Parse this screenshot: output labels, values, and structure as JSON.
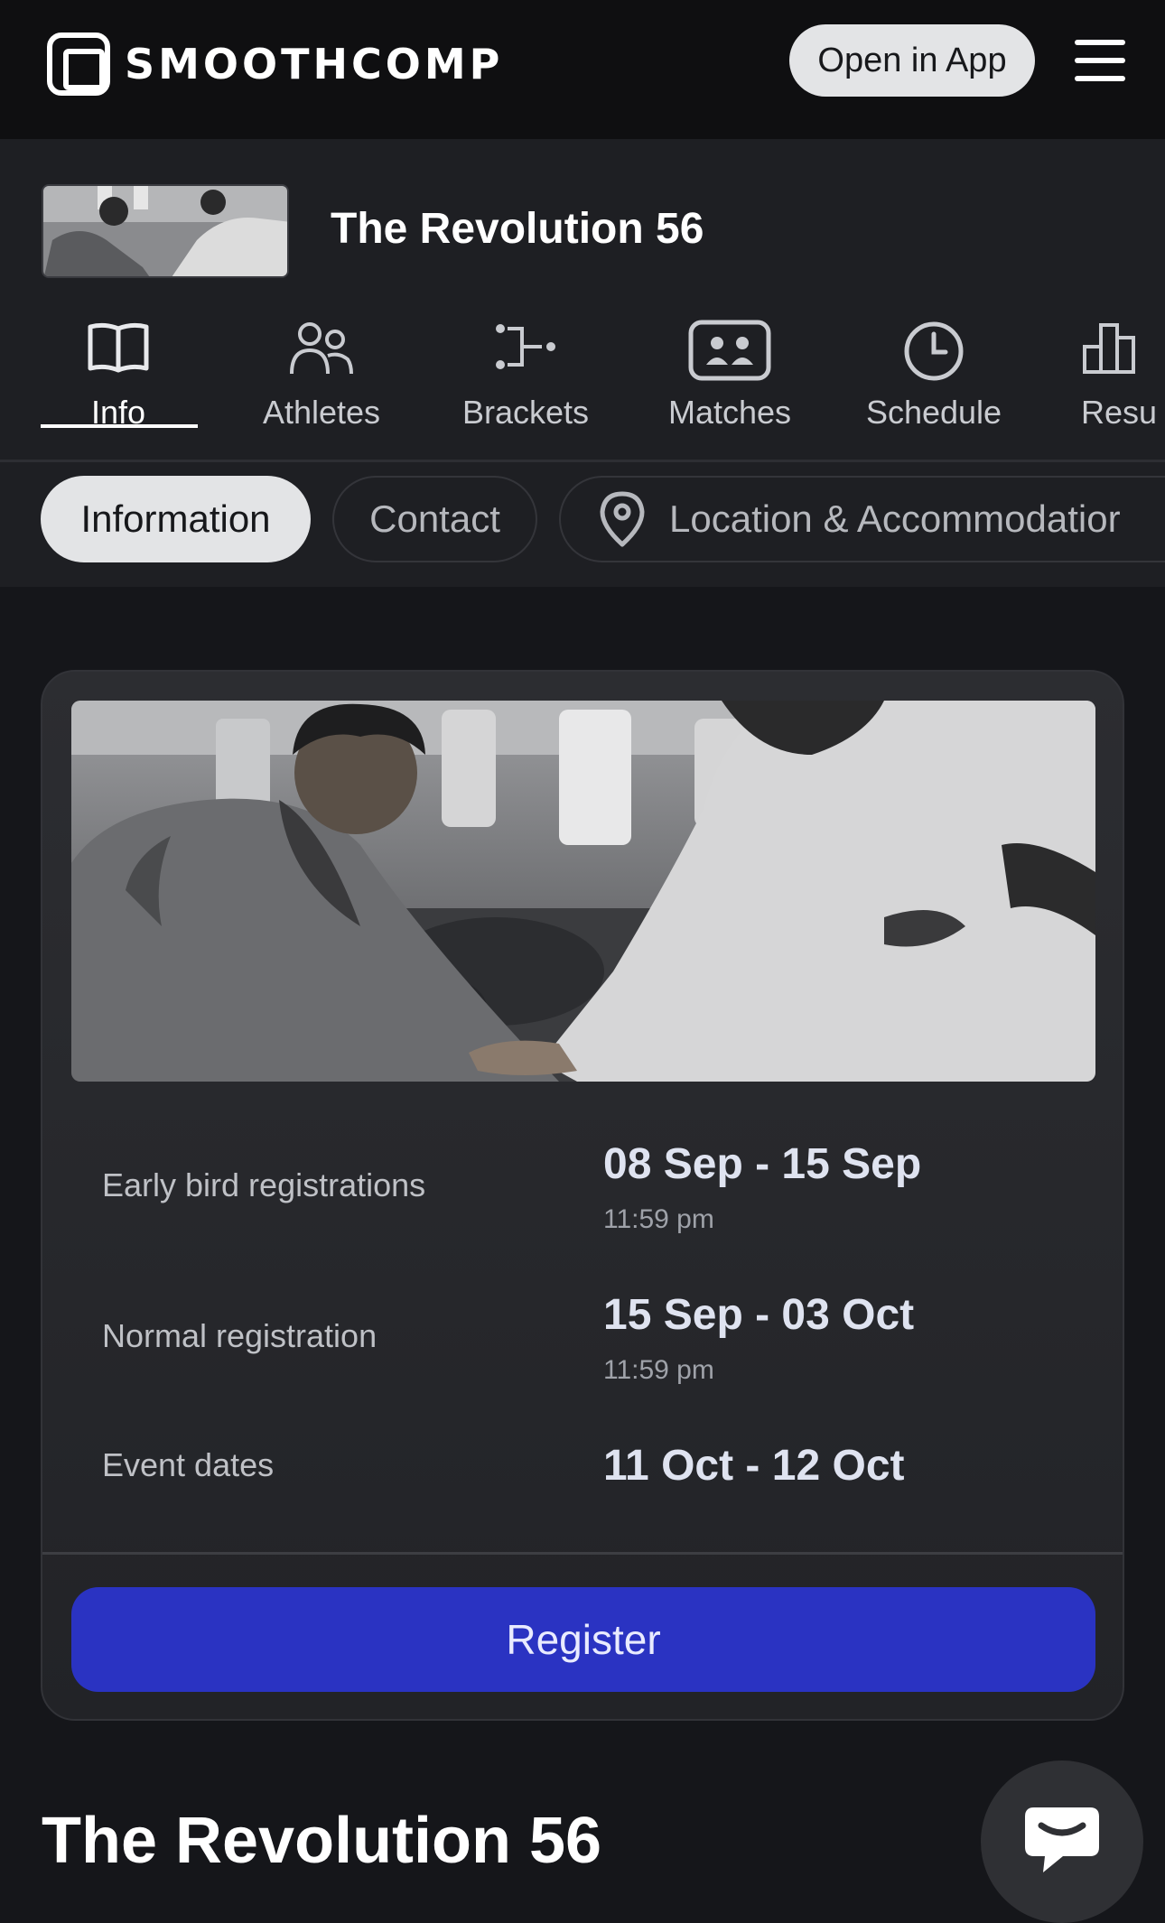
{
  "header": {
    "logo_text": "SMOOTHCOMP",
    "open_app_label": "Open in App"
  },
  "event": {
    "title": "The Revolution 56"
  },
  "tabs": [
    {
      "label": "Info",
      "icon": "book-icon",
      "active": true
    },
    {
      "label": "Athletes",
      "icon": "users-icon",
      "active": false
    },
    {
      "label": "Brackets",
      "icon": "bracket-icon",
      "active": false
    },
    {
      "label": "Matches",
      "icon": "match-icon",
      "active": false
    },
    {
      "label": "Schedule",
      "icon": "clock-icon",
      "active": false
    },
    {
      "label": "Resu",
      "icon": "podium-icon",
      "active": false
    }
  ],
  "subtabs": [
    {
      "label": "Information",
      "active": true
    },
    {
      "label": "Contact",
      "active": false
    },
    {
      "label": "Location & Accommodatior",
      "icon": "location-pin-icon",
      "active": false
    }
  ],
  "card": {
    "rows": [
      {
        "label": "Early bird registrations",
        "value": "08 Sep - 15 Sep",
        "time": "11:59 pm"
      },
      {
        "label": "Normal registration",
        "value": "15 Sep - 03 Oct",
        "time": "11:59 pm"
      },
      {
        "label": "Event dates",
        "value": "11 Oct - 12 Oct"
      }
    ],
    "register_label": "Register"
  },
  "bottom": {
    "title": "The Revolution 56"
  },
  "colors": {
    "background": "#15161a",
    "topbar": "#0f0f11",
    "accent": "#2a33c2",
    "pill_active": "#e3e4e6"
  }
}
